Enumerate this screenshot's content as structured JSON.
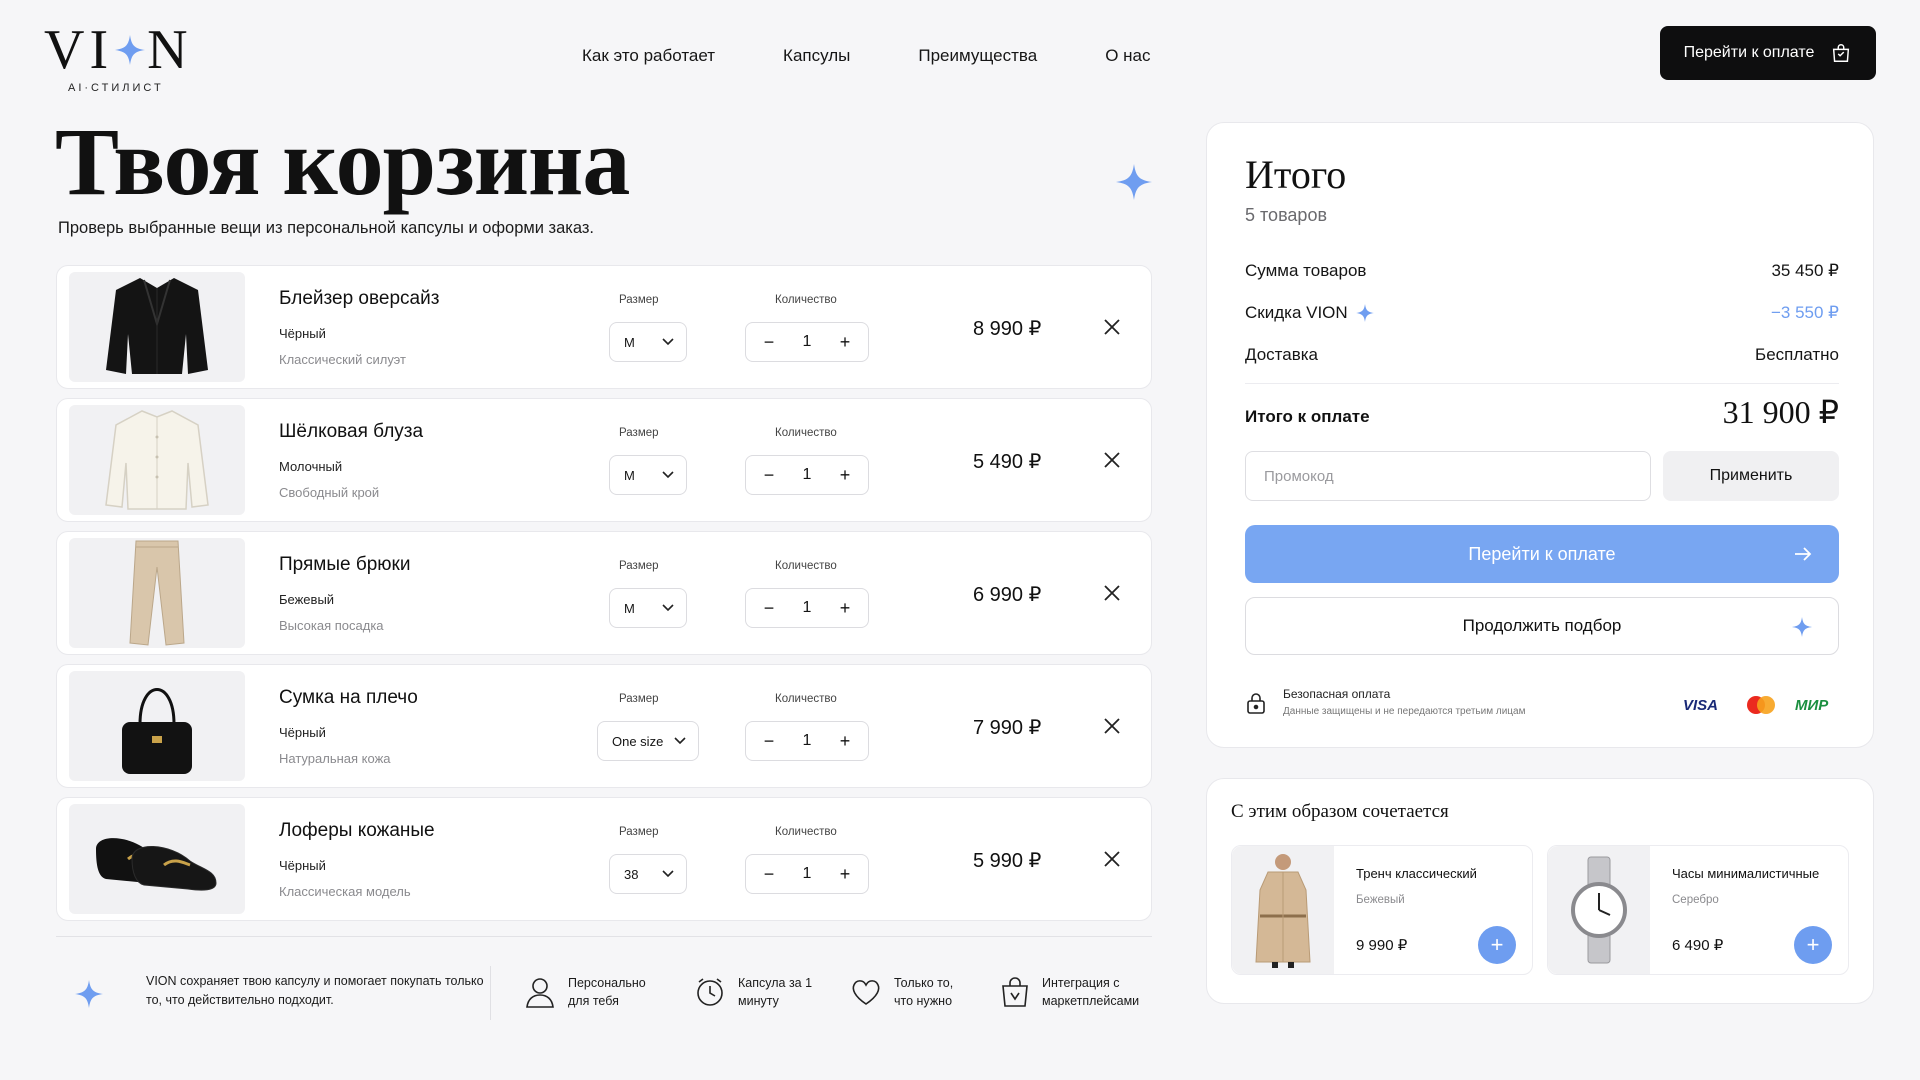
{
  "header": {
    "logo": "VION",
    "logo_sub": "AI·СТИЛИСТ",
    "nav": [
      "Как это работает",
      "Капсулы",
      "Преимущества",
      "О нас"
    ],
    "pay_button": "Перейти к оплате"
  },
  "page": {
    "title": "Твоя корзина",
    "subtitle": "Проверь выбранные вещи из персональной капсулы и оформи заказ."
  },
  "labels": {
    "size": "Размер",
    "quantity": "Количество",
    "minus": "−",
    "plus": "+"
  },
  "cart": [
    {
      "name": "Блейзер оверсайз",
      "color": "Чёрный",
      "note": "Классический силуэт",
      "size": "M",
      "qty": "1",
      "price": "8 990 ₽",
      "icon": "blazer"
    },
    {
      "name": "Шёлковая блуза",
      "color": "Молочный",
      "note": "Свободный крой",
      "size": "M",
      "qty": "1",
      "price": "5 490 ₽",
      "icon": "blouse"
    },
    {
      "name": "Прямые брюки",
      "color": "Бежевый",
      "note": "Высокая посадка",
      "size": "M",
      "qty": "1",
      "price": "6 990 ₽",
      "icon": "trousers"
    },
    {
      "name": "Сумка на плечо",
      "color": "Чёрный",
      "note": "Натуральная кожа",
      "size": "One size",
      "qty": "1",
      "price": "7 990 ₽",
      "icon": "bag"
    },
    {
      "name": "Лоферы кожаные",
      "color": "Чёрный",
      "note": "Классическая модель",
      "size": "38",
      "qty": "1",
      "price": "5 990 ₽",
      "icon": "loafers"
    }
  ],
  "strip": {
    "text": "VION сохраняет твою капсулу и помогает покупать только то, что действительно подходит.",
    "features": [
      {
        "text": "Персонально для тебя",
        "icon": "user-icon"
      },
      {
        "text": "Капсула за 1 минуту",
        "icon": "clock-icon"
      },
      {
        "text": "Только то, что нужно",
        "icon": "heart-icon"
      },
      {
        "text": "Интеграция с маркетплейсами",
        "icon": "shopping-bag-icon"
      }
    ]
  },
  "summary": {
    "title": "Итого",
    "count": "5 товаров",
    "subtotal_label": "Сумма товаров",
    "subtotal": "35 450 ₽",
    "discount_label": "Скидка VION",
    "discount": "−3 550 ₽",
    "delivery_label": "Доставка",
    "delivery": "Бесплатно",
    "total_label": "Итого к оплате",
    "total": "31 900 ₽",
    "promo_placeholder": "Промокод",
    "apply": "Применить",
    "pay": "Перейти к оплате",
    "continue": "Продолжить подбор",
    "secure_title": "Безопасная оплата",
    "secure_sub": "Данные защищены и не передаются третьим лицам",
    "payment_logos": [
      "VISA",
      "МИР"
    ]
  },
  "reco": {
    "title": "С этим образом сочетается",
    "items": [
      {
        "name": "Тренч классический",
        "note": "Бежевый",
        "price": "9 990 ₽",
        "icon": "trench"
      },
      {
        "name": "Часы минималистичные",
        "note": "Серебро",
        "price": "6 490 ₽",
        "icon": "watch"
      }
    ]
  },
  "colors": {
    "accent": "#78a6f2",
    "accent_dark": "#6e9df0",
    "dark": "#0e0e0f",
    "discount": "#6e9df0"
  }
}
